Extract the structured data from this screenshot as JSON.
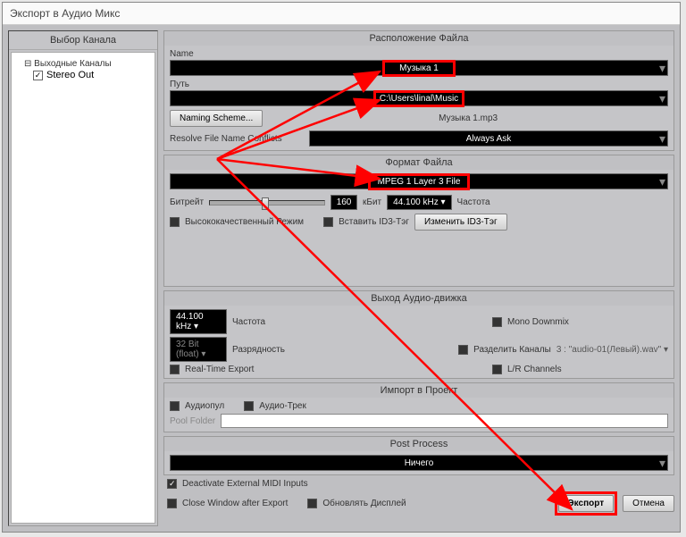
{
  "title": "Экспорт в Аудио Микс",
  "leftPanel": {
    "title": "Выбор Канала",
    "tree": {
      "parent": "Выходные Каналы",
      "child": "Stereo Out"
    }
  },
  "fileLocation": {
    "title": "Расположение Файла",
    "nameLabel": "Name",
    "nameValue": "Музыка 1",
    "pathLabel": "Путь",
    "pathValue": "C:\\Users\\linal\\Music",
    "namingScheme": "Naming Scheme...",
    "fileName": "Музыка 1.mp3",
    "conflictsLabel": "Resolve File Name Conflicts",
    "conflictsValue": "Always Ask"
  },
  "fileFormat": {
    "title": "Формат Файла",
    "formatValue": "MPEG 1 Layer 3 File",
    "bitrateLabel": "Битрейт",
    "bitrateValue": "160",
    "kbitLabel": "кБит",
    "sampleRateValue": "44.100 kHz",
    "sampleRateLabel": "Частота",
    "hqMode": "Высококачественный Режим",
    "insertId3": "Вставить ID3-Тэг",
    "editId3": "Изменить ID3-Тэг"
  },
  "audioEngine": {
    "title": "Выход Аудио-движка",
    "sampleRate": "44.100 kHz",
    "sampleRateLabel": "Частота",
    "bitDepth": "32 Bit (float)",
    "bitDepthLabel": "Разрядность",
    "realTime": "Real-Time Export",
    "monoDown": "Mono Downmix",
    "splitChannels": "Разделить Каналы",
    "splitExample": "3 : \"audio-01(Левый).wav\" ▾",
    "lrChannels": "L/R Channels"
  },
  "importProject": {
    "title": "Импорт в Проект",
    "audioPool": "Аудиопул",
    "audioTrack": "Аудио-Трек",
    "poolFolder": "Pool Folder"
  },
  "postProcess": {
    "title": "Post Process",
    "value": "Ничего"
  },
  "bottom": {
    "deactivateMidi": "Deactivate External MIDI Inputs",
    "closeWindow": "Close Window after Export",
    "updateDisplay": "Обновлять Дисплей",
    "export": "Экспорт",
    "cancel": "Отмена"
  }
}
